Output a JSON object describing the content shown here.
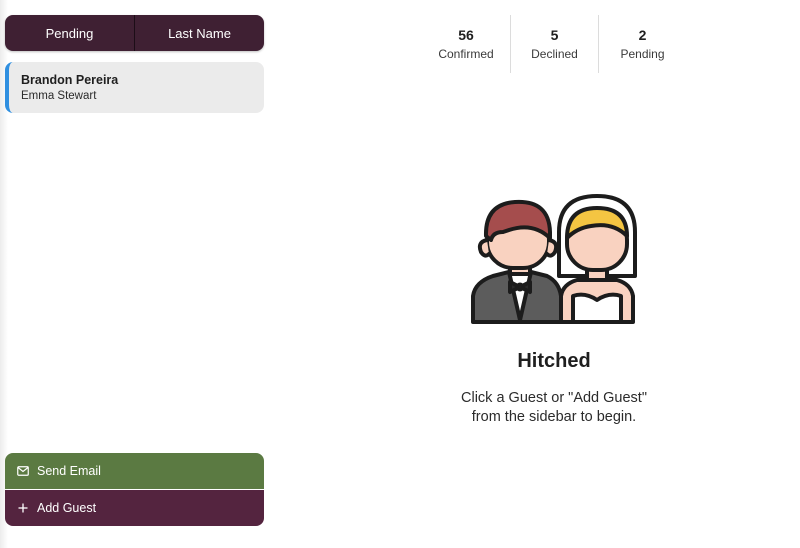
{
  "sidebar": {
    "sort_options": [
      "Pending",
      "Last Name"
    ],
    "guests": [
      {
        "name": "Brandon Pereira",
        "partner": "Emma Stewart"
      }
    ],
    "actions": {
      "send_email": "Send Email",
      "add_guest": "Add Guest"
    }
  },
  "stats": [
    {
      "value": "56",
      "label": "Confirmed"
    },
    {
      "value": "5",
      "label": "Declined"
    },
    {
      "value": "2",
      "label": "Pending"
    }
  ],
  "empty_state": {
    "title": "Hitched",
    "message_lines": [
      "Click a Guest or \"Add Guest\"",
      "from the sidebar to begin."
    ],
    "illustration_icon": "bride-and-groom-icon"
  },
  "colors": {
    "sidebar_accent": "#3f2033",
    "send_email_green": "#5b7a42",
    "add_guest_plum": "#54243f",
    "selected_indicator": "#2f8fe0"
  }
}
